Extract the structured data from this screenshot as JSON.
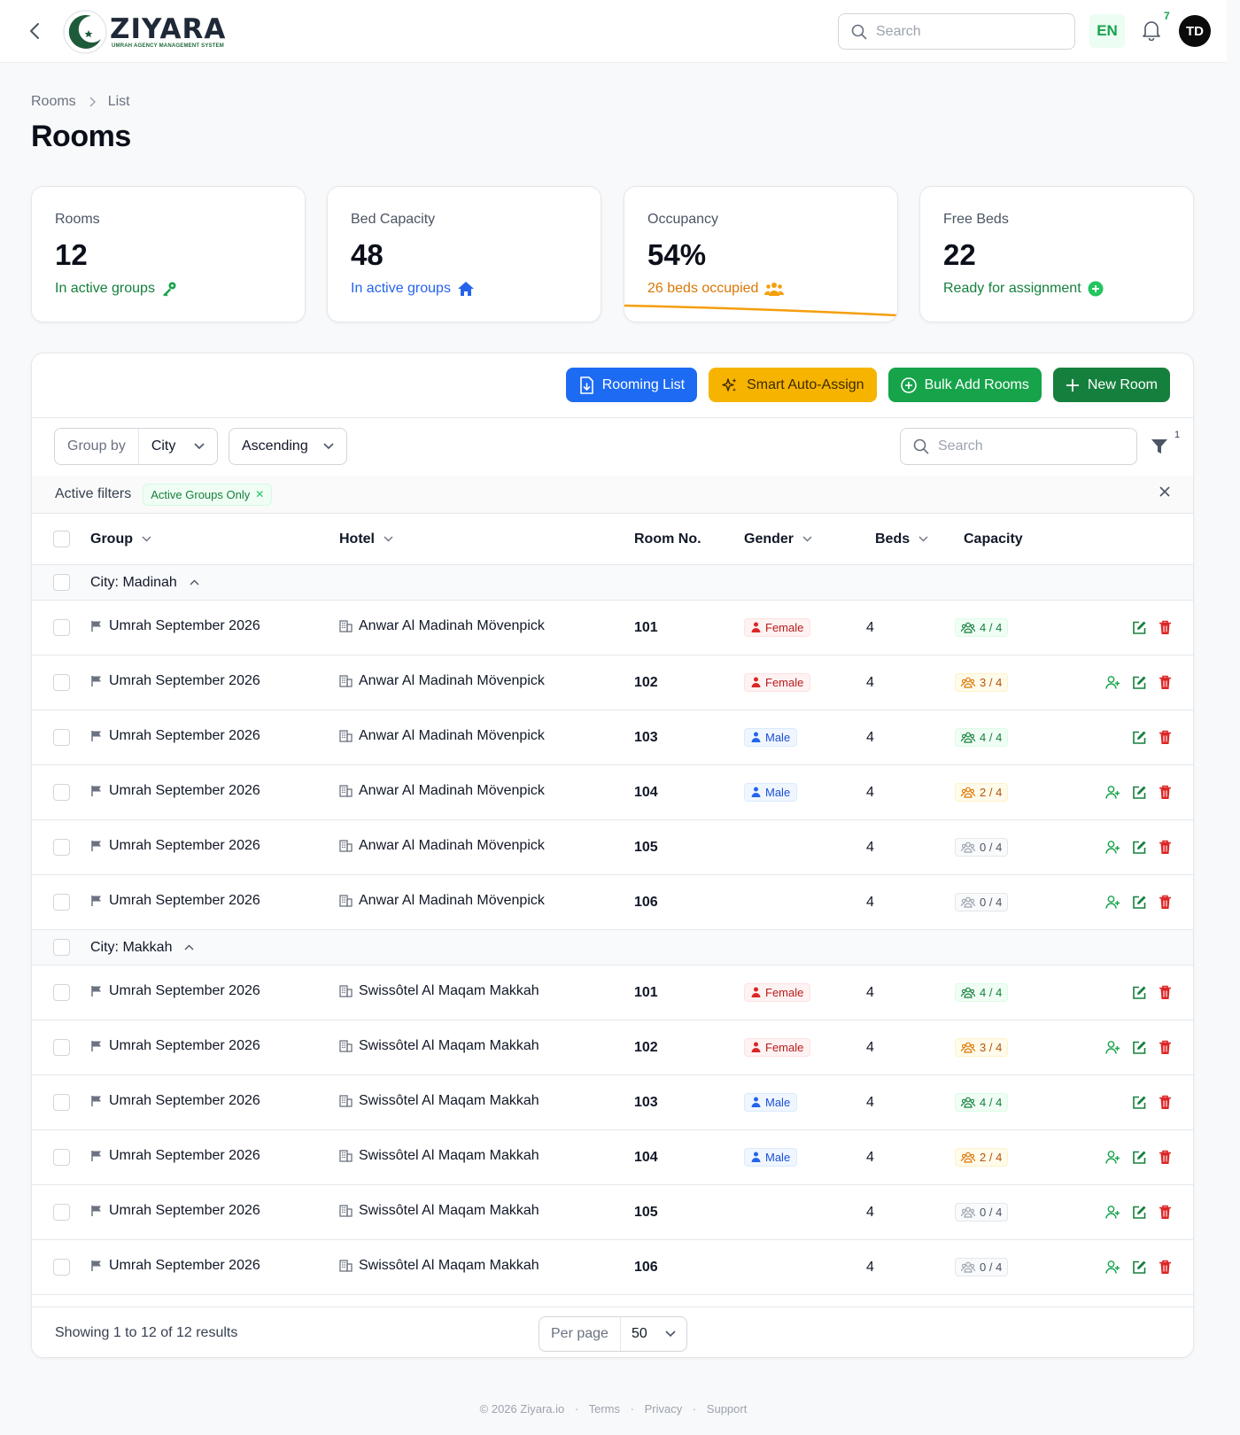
{
  "header": {
    "logo_name": "ZIYARA",
    "logo_tagline": "UMRAH AGENCY MANAGEMENT SYSTEM",
    "search_placeholder": "Search",
    "language": "EN",
    "notification_count": "7",
    "avatar_initials": "TD"
  },
  "breadcrumb": {
    "items": [
      "Rooms",
      "List"
    ]
  },
  "page": {
    "title": "Rooms"
  },
  "stats": [
    {
      "label": "Rooms",
      "value": "12",
      "desc": "In active groups",
      "icon": "key-icon"
    },
    {
      "label": "Bed Capacity",
      "value": "48",
      "desc": "In active groups",
      "icon": "home-icon"
    },
    {
      "label": "Occupancy",
      "value": "54%",
      "desc": "26 beds occupied",
      "icon": "users-icon",
      "progress_pct": 54
    },
    {
      "label": "Free Beds",
      "value": "22",
      "desc": "Ready for assignment",
      "icon": "plus-circle-icon"
    }
  ],
  "actions": {
    "rooming_list": "Rooming List",
    "smart_auto_assign": "Smart Auto-Assign",
    "bulk_add_rooms": "Bulk Add Rooms",
    "new_room": "New Room"
  },
  "toolbar": {
    "group_by_label": "Group by",
    "group_by_value": "City",
    "order_value": "Ascending",
    "search_placeholder": "Search",
    "filter_count": "1"
  },
  "filters": {
    "label": "Active filters",
    "chips": [
      "Active Groups Only"
    ]
  },
  "table": {
    "columns": [
      "Group",
      "Hotel",
      "Room No.",
      "Gender",
      "Beds",
      "Capacity"
    ],
    "groups": [
      {
        "label": "City: Madinah",
        "rows": [
          {
            "group": "Umrah September 2026",
            "hotel": "Anwar Al Madinah Mövenpick",
            "room": "101",
            "gender": "Female",
            "beds": "4",
            "capacity": "4 / 4",
            "status": "full"
          },
          {
            "group": "Umrah September 2026",
            "hotel": "Anwar Al Madinah Mövenpick",
            "room": "102",
            "gender": "Female",
            "beds": "4",
            "capacity": "3 / 4",
            "status": "part"
          },
          {
            "group": "Umrah September 2026",
            "hotel": "Anwar Al Madinah Mövenpick",
            "room": "103",
            "gender": "Male",
            "beds": "4",
            "capacity": "4 / 4",
            "status": "full"
          },
          {
            "group": "Umrah September 2026",
            "hotel": "Anwar Al Madinah Mövenpick",
            "room": "104",
            "gender": "Male",
            "beds": "4",
            "capacity": "2 / 4",
            "status": "part"
          },
          {
            "group": "Umrah September 2026",
            "hotel": "Anwar Al Madinah Mövenpick",
            "room": "105",
            "gender": "",
            "beds": "4",
            "capacity": "0 / 4",
            "status": "empty"
          },
          {
            "group": "Umrah September 2026",
            "hotel": "Anwar Al Madinah Mövenpick",
            "room": "106",
            "gender": "",
            "beds": "4",
            "capacity": "0 / 4",
            "status": "empty"
          }
        ]
      },
      {
        "label": "City: Makkah",
        "rows": [
          {
            "group": "Umrah September 2026",
            "hotel": "Swissôtel Al Maqam Makkah",
            "room": "101",
            "gender": "Female",
            "beds": "4",
            "capacity": "4 / 4",
            "status": "full"
          },
          {
            "group": "Umrah September 2026",
            "hotel": "Swissôtel Al Maqam Makkah",
            "room": "102",
            "gender": "Female",
            "beds": "4",
            "capacity": "3 / 4",
            "status": "part"
          },
          {
            "group": "Umrah September 2026",
            "hotel": "Swissôtel Al Maqam Makkah",
            "room": "103",
            "gender": "Male",
            "beds": "4",
            "capacity": "4 / 4",
            "status": "full"
          },
          {
            "group": "Umrah September 2026",
            "hotel": "Swissôtel Al Maqam Makkah",
            "room": "104",
            "gender": "Male",
            "beds": "4",
            "capacity": "2 / 4",
            "status": "part"
          },
          {
            "group": "Umrah September 2026",
            "hotel": "Swissôtel Al Maqam Makkah",
            "room": "105",
            "gender": "",
            "beds": "4",
            "capacity": "0 / 4",
            "status": "empty"
          },
          {
            "group": "Umrah September 2026",
            "hotel": "Swissôtel Al Maqam Makkah",
            "room": "106",
            "gender": "",
            "beds": "4",
            "capacity": "0 / 4",
            "status": "empty"
          }
        ]
      }
    ]
  },
  "pagination": {
    "showing": "Showing 1 to 12 of 12 results",
    "per_page_label": "Per page",
    "per_page_value": "50"
  },
  "footer": {
    "copyright": "© 2026 Ziyara.io",
    "links": [
      "Terms",
      "Privacy",
      "Support"
    ]
  },
  "colors": {
    "brand_green": "#16a34a",
    "accent_blue": "#1d6bf2",
    "accent_yellow": "#f6b400",
    "danger_red": "#dc2626"
  }
}
